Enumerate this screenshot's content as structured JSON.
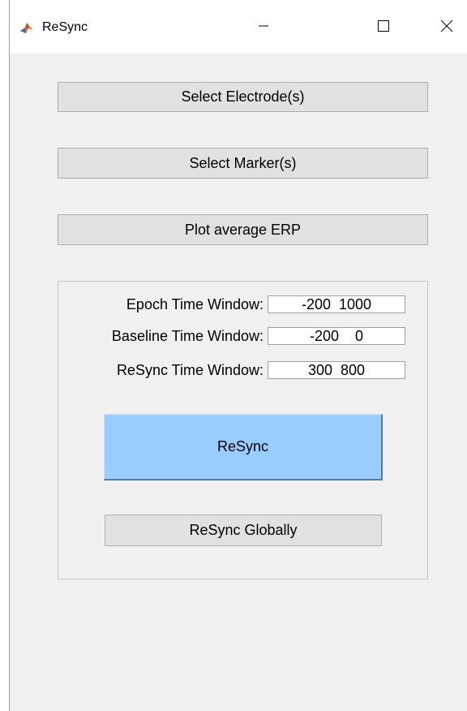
{
  "window": {
    "title": "ReSync",
    "app_icon": "matlab-icon",
    "controls": {
      "minimize_icon": "minimize-icon",
      "maximize_icon": "maximize-icon",
      "close_icon": "close-icon"
    }
  },
  "buttons": {
    "select_electrodes": "Select Electrode(s)",
    "select_markers": "Select Marker(s)",
    "plot_erp": "Plot average ERP"
  },
  "panel": {
    "fields": [
      {
        "label": "Epoch Time Window:",
        "value": "-200  1000"
      },
      {
        "label": "Baseline Time Window:",
        "value": "-200    0"
      },
      {
        "label": "ReSync Time Window:",
        "value": "300  800"
      }
    ],
    "resync_label": "ReSync",
    "resync_globally_label": "ReSync Globally"
  },
  "colors": {
    "resync_button": "#99ccff",
    "window_bg": "#f0f0f0",
    "button_bg": "#e1e1e1"
  }
}
